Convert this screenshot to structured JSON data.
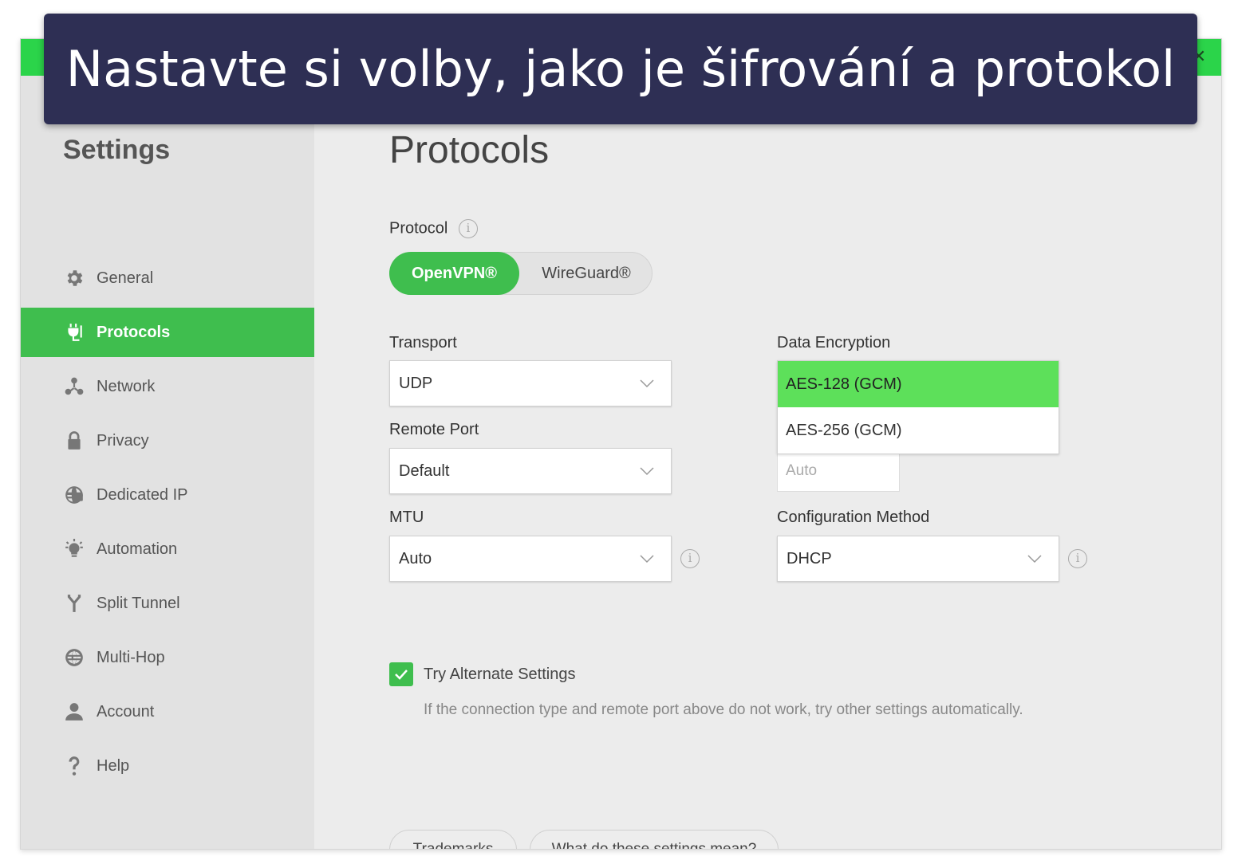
{
  "banner": {
    "text": "Nastavte si volby, jako je šifrování a protokol"
  },
  "titlebar": {
    "close_glyph": "✕"
  },
  "sidebar": {
    "title": "Settings",
    "items": [
      {
        "label": "General",
        "icon": "gear-icon"
      },
      {
        "label": "Protocols",
        "icon": "plug-icon",
        "active": true
      },
      {
        "label": "Network",
        "icon": "network-icon"
      },
      {
        "label": "Privacy",
        "icon": "lock-icon"
      },
      {
        "label": "Dedicated IP",
        "icon": "globe-ip-icon"
      },
      {
        "label": "Automation",
        "icon": "bulb-icon"
      },
      {
        "label": "Split Tunnel",
        "icon": "split-icon"
      },
      {
        "label": "Multi-Hop",
        "icon": "multi-globe-icon"
      },
      {
        "label": "Account",
        "icon": "user-icon"
      },
      {
        "label": "Help",
        "icon": "question-icon"
      }
    ]
  },
  "main": {
    "title": "Protocols",
    "protocol": {
      "label": "Protocol",
      "info_glyph": "i",
      "options": [
        "OpenVPN®",
        "WireGuard®"
      ],
      "selected": "OpenVPN®"
    },
    "transport": {
      "label": "Transport",
      "value": "UDP"
    },
    "remote_port": {
      "label": "Remote Port",
      "value": "Default"
    },
    "mtu": {
      "label": "MTU",
      "value": "Auto",
      "info_glyph": "i"
    },
    "data_encryption": {
      "label": "Data Encryption",
      "options": [
        "AES-128 (GCM)",
        "AES-256 (GCM)"
      ],
      "selected": "AES-128 (GCM)"
    },
    "port_field": {
      "value": "Auto"
    },
    "configuration_method": {
      "label": "Configuration Method",
      "value": "DHCP",
      "info_glyph": "i"
    },
    "alternate": {
      "label": "Try Alternate Settings",
      "checked": true,
      "hint": "If the connection type and remote port above do not work, try other settings automatically."
    },
    "buttons": {
      "trademarks": "Trademarks",
      "help": "What do these settings mean?"
    }
  },
  "colors": {
    "accent": "#3fbe4e",
    "titlebar": "#2bd44a",
    "highlight": "#5de05a",
    "banner": "#2e2f54"
  }
}
